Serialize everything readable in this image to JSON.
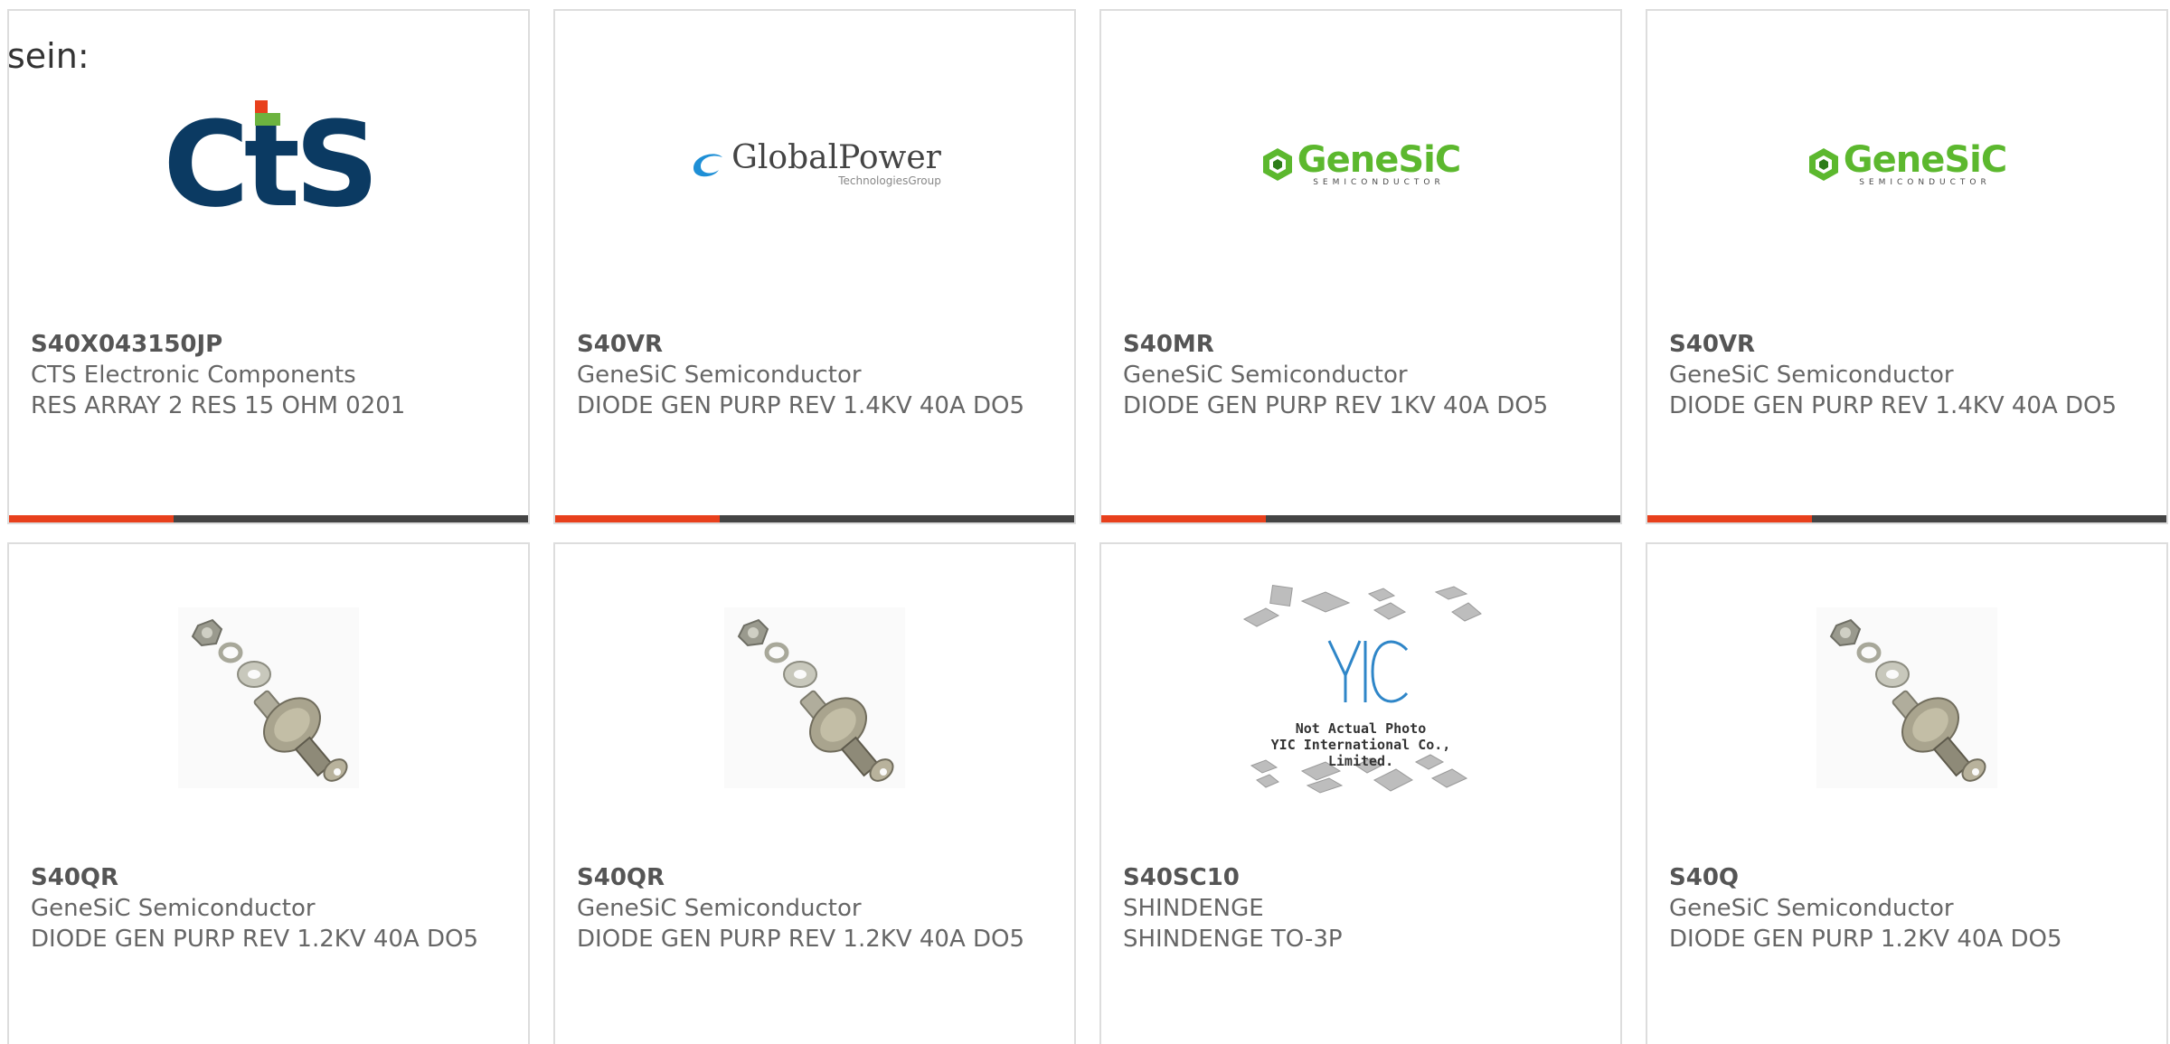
{
  "intro_text": "sein:",
  "colors": {
    "accent": "#e8401c",
    "bar": "#444444",
    "border": "#dddddd",
    "cts_blue": "#0b3a62",
    "genesic_green": "#5cb82e"
  },
  "cards": [
    {
      "part": "S40X043150JP",
      "manufacturer": "CTS Electronic Components",
      "description": "RES ARRAY 2 RES 15 OHM 0201",
      "image": "cts-logo",
      "logo_text": "CtS"
    },
    {
      "part": "S40VR",
      "manufacturer": "GeneSiC Semiconductor",
      "description": "DIODE GEN PURP REV 1.4KV 40A DO5",
      "image": "globalpower-logo",
      "logo_text": "GlobalPower",
      "logo_sub": "TechnologiesGroup"
    },
    {
      "part": "S40MR",
      "manufacturer": "GeneSiC Semiconductor",
      "description": "DIODE GEN PURP REV 1KV 40A DO5",
      "image": "genesic-logo",
      "logo_text": "GeneSiC",
      "logo_sub": "SEMICONDUCTOR"
    },
    {
      "part": "S40VR",
      "manufacturer": "GeneSiC Semiconductor",
      "description": "DIODE GEN PURP REV 1.4KV 40A DO5",
      "image": "genesic-logo",
      "logo_text": "GeneSiC",
      "logo_sub": "SEMICONDUCTOR"
    },
    {
      "part": "S40QR",
      "manufacturer": "GeneSiC Semiconductor",
      "description": "DIODE GEN PURP REV 1.2KV 40A DO5",
      "image": "stud-diode-photo"
    },
    {
      "part": "S40QR",
      "manufacturer": "GeneSiC Semiconductor",
      "description": "DIODE GEN PURP REV 1.2KV 40A DO5",
      "image": "stud-diode-photo"
    },
    {
      "part": "S40SC10",
      "manufacturer": "SHINDENGE",
      "description": "SHINDENGE TO-3P",
      "image": "yic-placeholder",
      "logo_text": "YIC",
      "caption_line1": "Not Actual Photo",
      "caption_line2": "YIC International Co., Limited."
    },
    {
      "part": "S40Q",
      "manufacturer": "GeneSiC Semiconductor",
      "description": "DIODE GEN PURP 1.2KV 40A DO5",
      "image": "stud-diode-photo"
    }
  ]
}
